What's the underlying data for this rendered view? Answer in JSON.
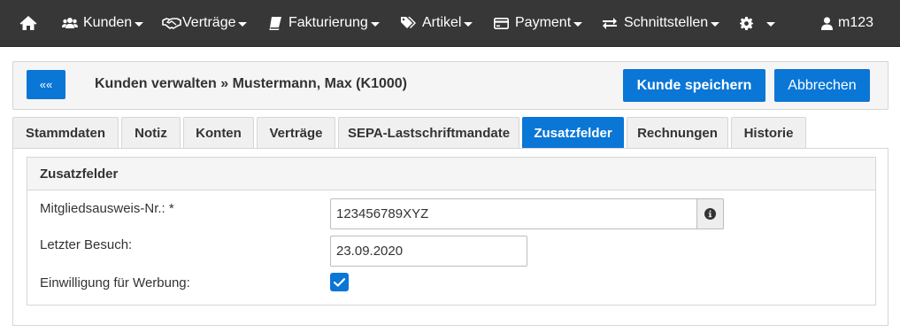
{
  "nav": {
    "home_icon": "home-icon",
    "items": [
      {
        "label": "Kunden",
        "icon": "users-icon"
      },
      {
        "label": "Verträge",
        "icon": "handshake-icon"
      },
      {
        "label": "Fakturierung",
        "icon": "book-icon"
      },
      {
        "label": "Artikel",
        "icon": "tags-icon"
      },
      {
        "label": "Payment",
        "icon": "credit-card-icon"
      },
      {
        "label": "Schnittstellen",
        "icon": "exchange-icon"
      }
    ],
    "settings_icon": "gear-icon",
    "user": {
      "label": "m123",
      "icon": "user-icon"
    }
  },
  "header": {
    "back_label": "««",
    "title": "Kunden verwalten » Mustermann, Max (K1000)",
    "save_label": "Kunde speichern",
    "cancel_label": "Abbrechen"
  },
  "tabs": [
    {
      "label": "Stammdaten",
      "active": false
    },
    {
      "label": "Notiz",
      "active": false
    },
    {
      "label": "Konten",
      "active": false
    },
    {
      "label": "Verträge",
      "active": false
    },
    {
      "label": "SEPA-Lastschriftmandate",
      "active": false
    },
    {
      "label": "Zusatzfelder",
      "active": true
    },
    {
      "label": "Rechnungen",
      "active": false
    },
    {
      "label": "Historie",
      "active": false
    }
  ],
  "panel": {
    "title": "Zusatzfelder",
    "fields": [
      {
        "label": "Mitgliedsausweis-Nr.: *",
        "value": "123456789XYZ",
        "addon_icon": "info-icon"
      },
      {
        "label": "Letzter Besuch:",
        "value": "23.09.2020"
      },
      {
        "label": "Einwilligung für Werbung:",
        "checked": true
      }
    ]
  },
  "colors": {
    "navbar": "#373737",
    "primary": "#0a76d6"
  }
}
